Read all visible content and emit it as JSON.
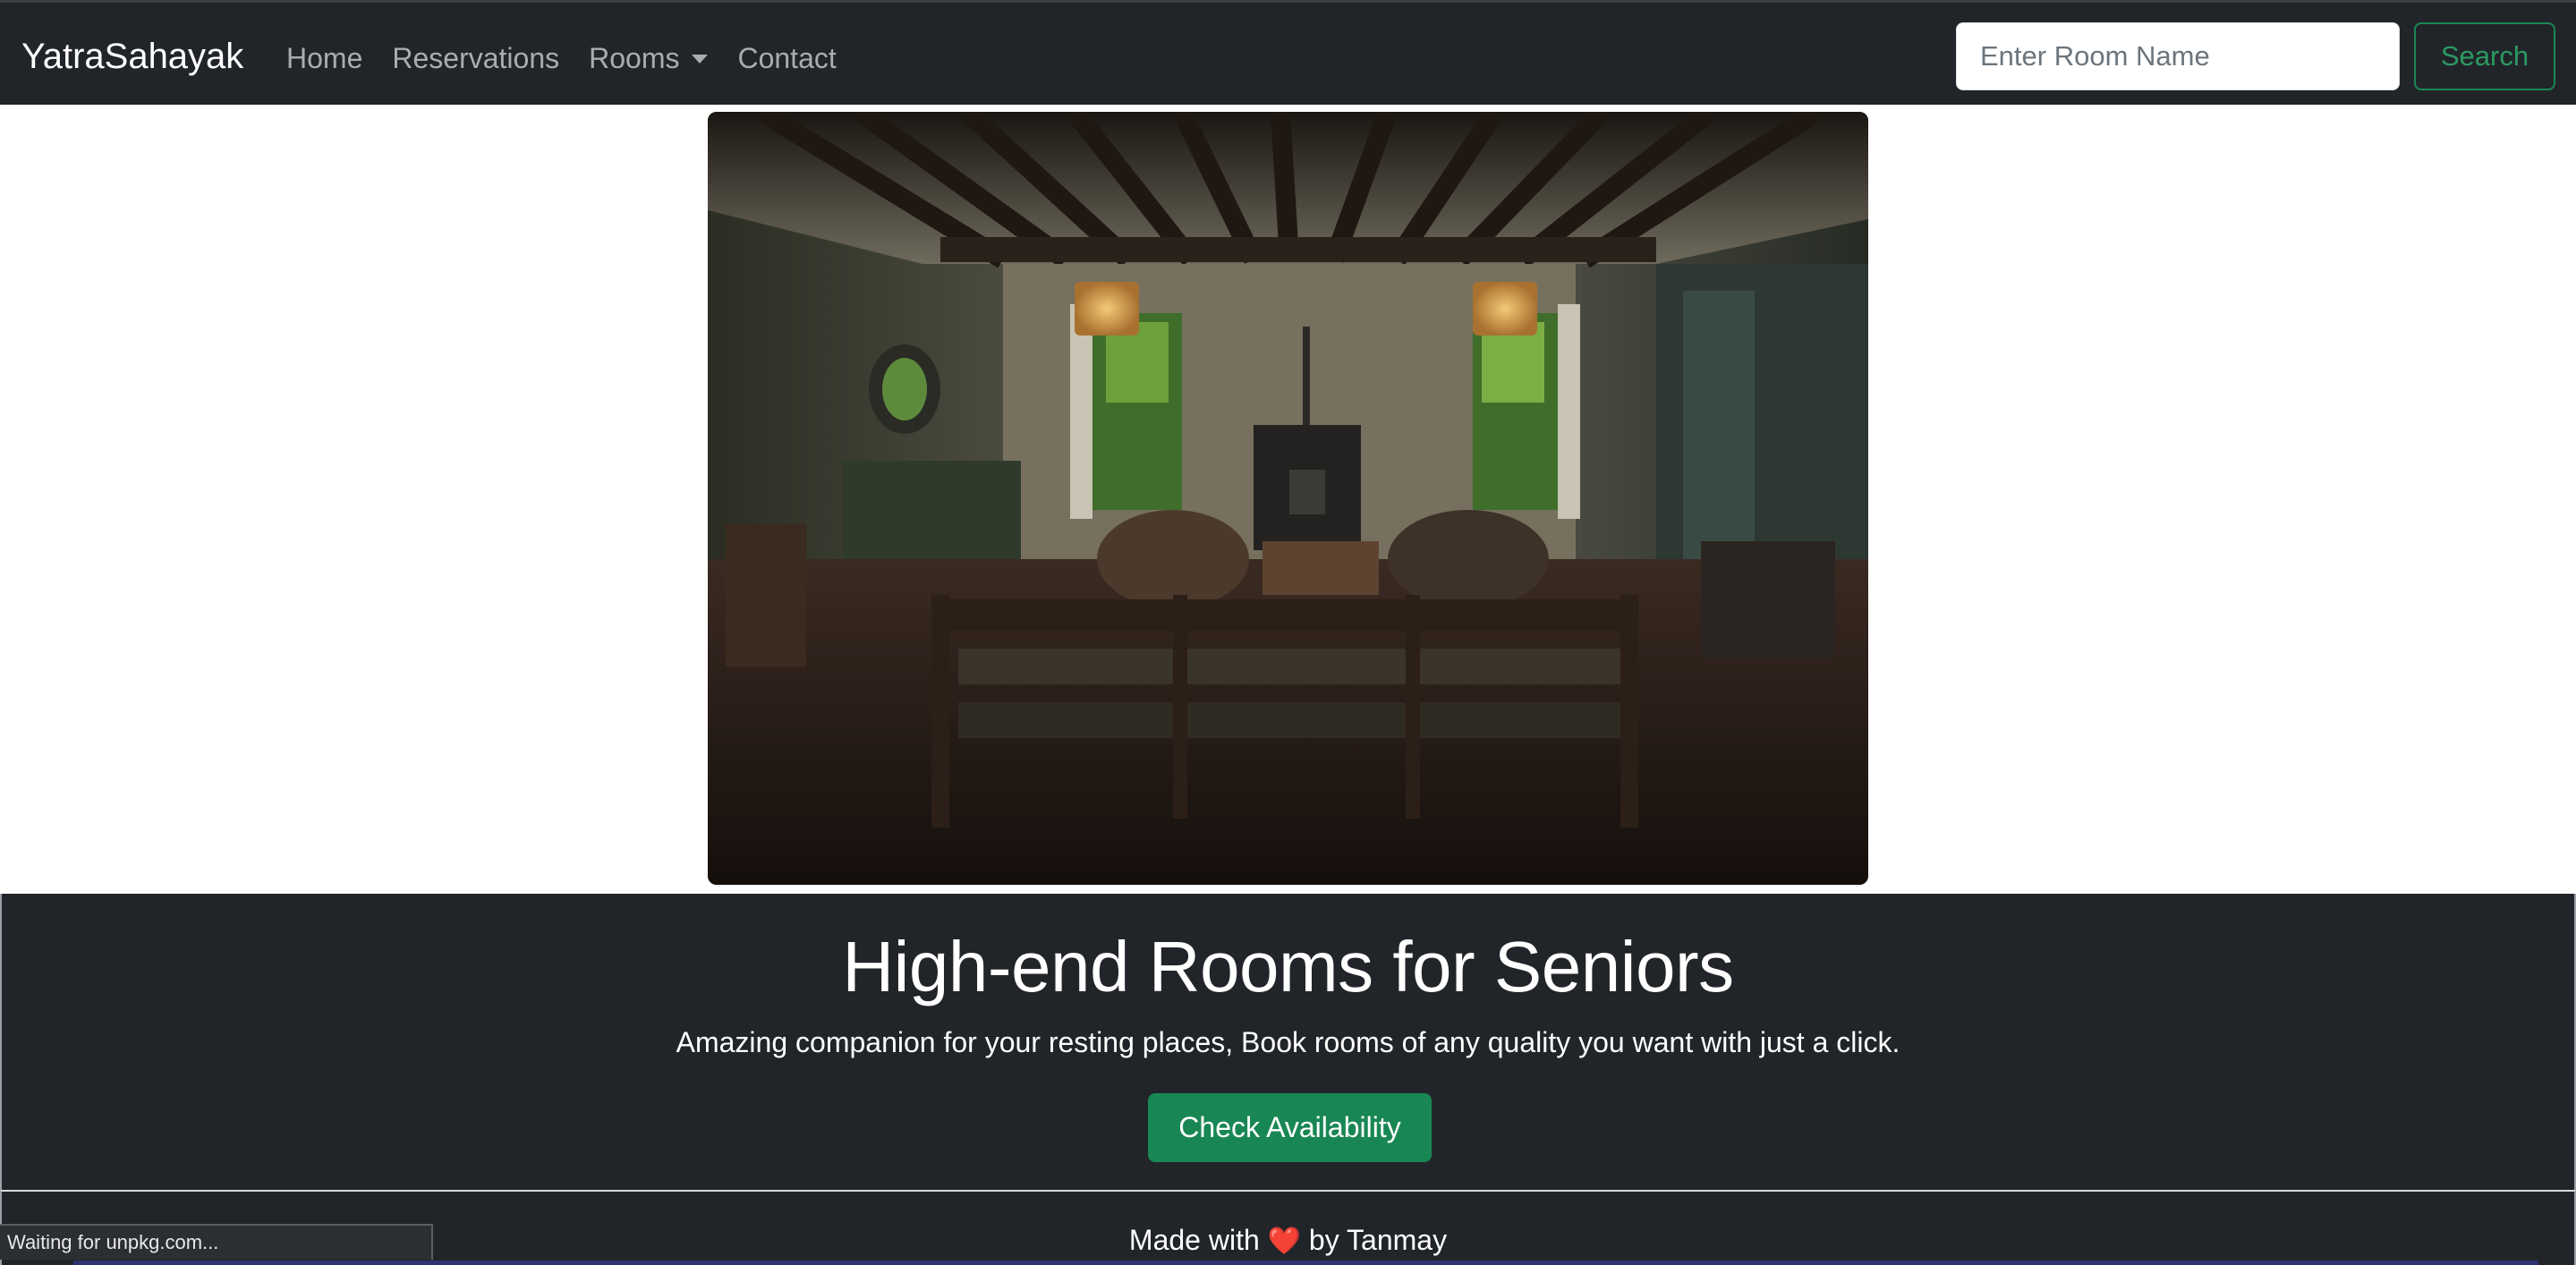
{
  "navbar": {
    "brand": "YatraSahayak",
    "links": [
      {
        "label": "Home"
      },
      {
        "label": "Reservations"
      },
      {
        "label": "Rooms"
      },
      {
        "label": "Contact"
      }
    ],
    "search": {
      "placeholder": "Enter Room Name",
      "value": "",
      "button_label": "Search"
    }
  },
  "hero": {
    "image_icon": "living-room-photo"
  },
  "intro": {
    "title": "High-end Rooms for Seniors",
    "subtitle": "Amazing companion for your resting places, Book rooms of any quality you want with just a click.",
    "cta_label": "Check Availability"
  },
  "footer": {
    "prefix": "Made with",
    "heart": "❤️",
    "suffix": "by Tanmay"
  },
  "status_bar": {
    "text": "Waiting for unpkg.com..."
  },
  "colors": {
    "navbar_bg": "#212529",
    "accent_green": "#198754",
    "heart_red": "#d9342b"
  }
}
